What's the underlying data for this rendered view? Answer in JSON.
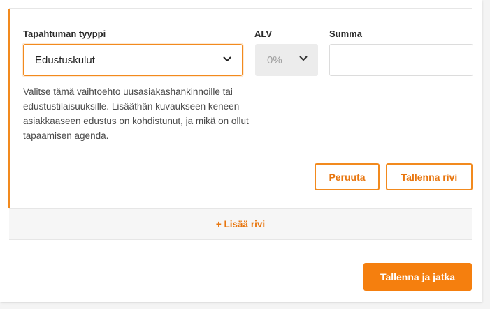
{
  "form": {
    "type_label": "Tapahtuman tyyppi",
    "type_value": "Edustuskulut",
    "vat_label": "ALV",
    "vat_value": "0%",
    "sum_label": "Summa",
    "sum_value": "",
    "help_text": "Valitse tämä vaihtoehto uusasiakashankinnoille tai edustustilaisuuksille. Lisääthän kuvaukseen keneen asiakkaaseen edustus on kohdistunut, ja mikä on ollut tapaamisen agenda.",
    "cancel_label": "Peruuta",
    "save_row_label": "Tallenna rivi"
  },
  "add_row_label": "+ Lisää rivi",
  "save_continue_label": "Tallenna ja jatka",
  "icons": {
    "type_dropdown": "chevron-down-icon",
    "vat_dropdown": "chevron-down-icon"
  },
  "colors": {
    "accent": "#f28a1e",
    "primary_button": "#f57f0e",
    "disabled_bg": "#ececec"
  }
}
